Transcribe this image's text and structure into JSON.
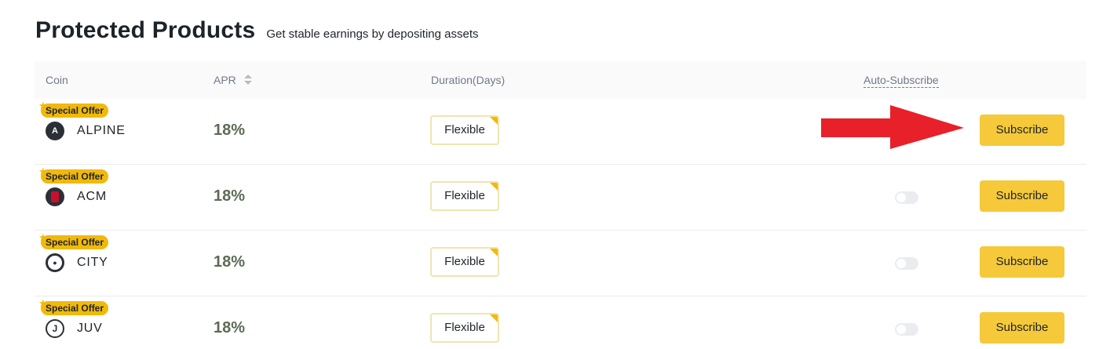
{
  "header": {
    "title": "Protected Products",
    "subtitle": "Get stable earnings by depositing assets"
  },
  "table": {
    "columns": {
      "coin": "Coin",
      "apr": "APR",
      "duration": "Duration(Days)",
      "auto_subscribe": "Auto-Subscribe"
    },
    "rows": [
      {
        "badge": "Special Offer",
        "coin": "ALPINE",
        "coin_icon": "alpine-logo-icon",
        "apr": "18%",
        "duration": "Flexible",
        "action": "Subscribe",
        "auto_subscribe_toggle": false
      },
      {
        "badge": "Special Offer",
        "coin": "ACM",
        "coin_icon": "acm-logo-icon",
        "apr": "18%",
        "duration": "Flexible",
        "action": "Subscribe",
        "auto_subscribe_toggle": true
      },
      {
        "badge": "Special Offer",
        "coin": "CITY",
        "coin_icon": "city-logo-icon",
        "apr": "18%",
        "duration": "Flexible",
        "action": "Subscribe",
        "auto_subscribe_toggle": true
      },
      {
        "badge": "Special Offer",
        "coin": "JUV",
        "coin_icon": "juv-logo-icon",
        "apr": "18%",
        "duration": "Flexible",
        "action": "Subscribe",
        "auto_subscribe_toggle": true
      }
    ]
  },
  "colors": {
    "accent": "#f0b90b",
    "button": "#f5c93a",
    "apr_text": "#5b6b55",
    "arrow": "#e8202a"
  }
}
